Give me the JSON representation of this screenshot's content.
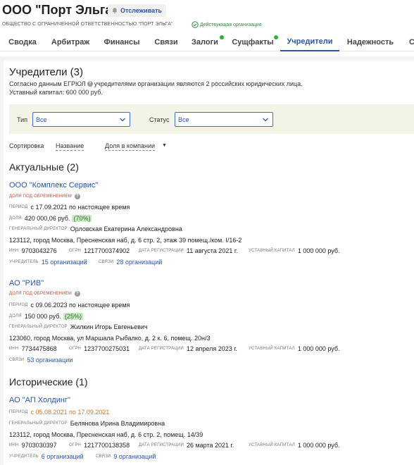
{
  "header": {
    "company_title": "ООО \"Порт Эльга\"",
    "follow_label": "Отслеживать",
    "full_name": "ОБЩЕСТВО С ОГРАНИЧЕННОЙ ОТВЕТСТВЕННОСТЬЮ \"ПОРТ ЭЛЬГА\"",
    "status": "Действующая организация"
  },
  "tabs": [
    {
      "label": "Сводка"
    },
    {
      "label": "Арбитраж"
    },
    {
      "label": "Финансы"
    },
    {
      "label": "Связи"
    },
    {
      "label": "Залоги"
    },
    {
      "label": "Сущфакты"
    },
    {
      "label": "Учредители"
    },
    {
      "label": "Надежность"
    },
    {
      "label": "С"
    }
  ],
  "active_tab": "Учредители",
  "section": {
    "title": "Учредители (3)",
    "egrul_note": "Согласно данным ЕГРЮЛ",
    "egrul_note2": "учредителями организации являются 2 российских юридических лица.",
    "capital": "Уставный капитал: 600 000 руб."
  },
  "filters": {
    "type_label": "Тип",
    "type_value": "Все",
    "status_label": "Статус",
    "status_value": "Все"
  },
  "sort": {
    "label": "Сортировка",
    "by_name": "Название",
    "by_share": "Доля в компании"
  },
  "labels": {
    "burden": "ДОЛЯ ПОД ОБРЕМЕНЕНИЕМ",
    "period": "ПЕРИОД",
    "share": "ДОЛЯ",
    "director": "ГЕНЕРАЛЬНЫЙ ДИРЕКТОР",
    "inn": "ИНН",
    "ogrn": "ОГРН",
    "reg_date": "ДАТА РЕГИСТРАЦИИ",
    "capital": "УСТАВНЫЙ КАПИТАЛ",
    "founder": "УЧРЕДИТЕЛЬ",
    "links": "СВЯЗИ"
  },
  "current": {
    "title": "Актуальные (2)",
    "items": [
      {
        "name": "ООО \"Комплекс Сервис\"",
        "period": "с 17.09.2021 по настоящее время",
        "share": "420 000,06 руб.",
        "share_pct": "(70%)",
        "director": "Орловская Екатерина Александровна",
        "address": "123112, город Москва, Пресненская наб, д. 6 стр. 2, этаж 39 помещ./ком. I/16-2",
        "inn": "9703043276",
        "ogrn": "1217700374902",
        "reg_date": "11 августа 2021 г.",
        "capital": "1 000 000 руб.",
        "founder": "15 организаций",
        "links": "28 организаций"
      },
      {
        "name": "АО \"РИВ\"",
        "period": "с 09.06.2023 по настоящее время",
        "share": "150 000 руб.",
        "share_pct": "(25%)",
        "director": "Жилкин Игорь Евгеньевич",
        "address": "123060, город Москва, ул Маршала Рыбалко, д. 2 к. 6, помещ. 20н/3",
        "inn": "7734475868",
        "ogrn": "1237700275031",
        "reg_date": "12 апреля 2023 г.",
        "capital": "1 000 000 руб.",
        "links": "53 организации"
      }
    ]
  },
  "historical": {
    "title": "Исторические (1)",
    "items": [
      {
        "name": "АО \"АП Холдинг\"",
        "period": "с 05.08.2021 по 17.09.2021",
        "director": "Белянова Ирина Владимировна",
        "address": "123112, город Москва, Пресненская наб, д. 6 стр. 2, помещ. 14/39",
        "inn": "9703030397",
        "ogrn": "1217700138358",
        "reg_date": "26 марта 2021 г.",
        "capital": "1 000 000 руб.",
        "founder": "6 организаций",
        "links": "9 организаций"
      }
    ]
  },
  "colors": {
    "accent": "#2b56a6",
    "active_green": "#2e8b3a",
    "burden_red": "#d5452f",
    "period_orange": "#d9731b",
    "filter_bg": "#f3f3e6"
  }
}
